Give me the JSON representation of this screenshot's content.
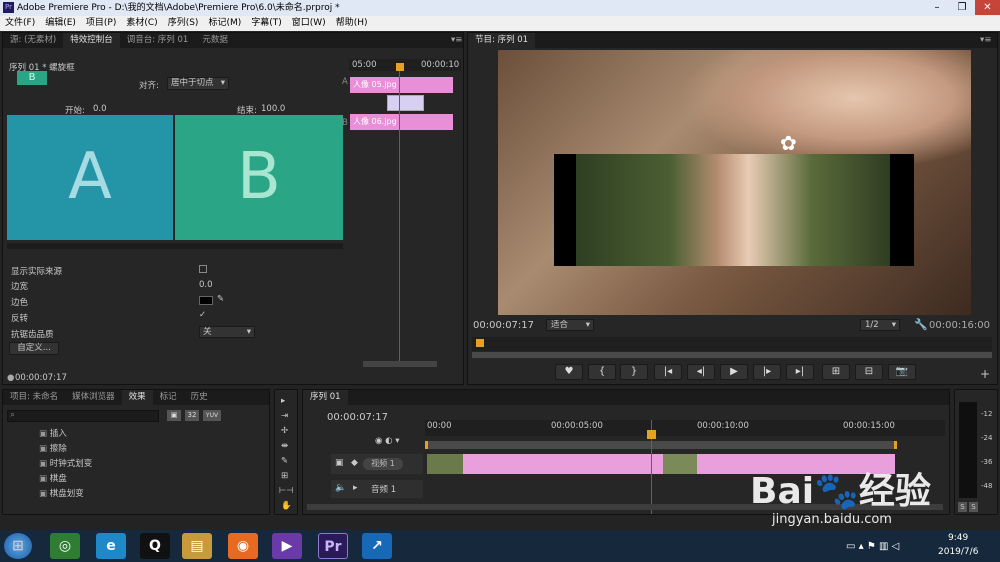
{
  "window": {
    "title": "Adobe Premiere Pro - D:\\我的文档\\Adobe\\Premiere Pro\\6.0\\未命名.prproj *",
    "app_icon": "Pr"
  },
  "menu": [
    "文件(F)",
    "编辑(E)",
    "项目(P)",
    "素材(C)",
    "序列(S)",
    "标记(M)",
    "字幕(T)",
    "窗口(W)",
    "帮助(H)"
  ],
  "left_tabs": [
    "源: (无素材)",
    "特效控制台",
    "调音台: 序列 01",
    "元数据"
  ],
  "effect_controls": {
    "clip_title": "序列 01 * 螺旋框",
    "align_label": "对齐:",
    "align_value": "居中于切点",
    "start_label": "开始:",
    "start_value": "0.0",
    "end_label": "结束:",
    "end_value": "100.0",
    "letter_a": "A",
    "letter_b": "B",
    "thumb_letter": "B",
    "show_source": "显示实际来源",
    "border_width_label": "边宽",
    "border_width_value": "0.0",
    "border_color_label": "边色",
    "reverse_label": "反转",
    "reverse_mark": "✓",
    "aa_label": "抗锯齿品质",
    "aa_value": "关",
    "custom_button": "自定义...",
    "timecode": "00:00:07:17",
    "mini_ruler": [
      "05:00",
      "00:00:10"
    ],
    "clip_a": "人像 05.jpg",
    "clip_b": "人像 06.jpg",
    "a_marker": "A",
    "b_marker": "B"
  },
  "program": {
    "tab": "节目: 序列 01",
    "timecode": "00:00:07:17",
    "fit": "适合",
    "quality": "1/2",
    "duration": "00:00:16:00"
  },
  "transport": [
    "♥",
    "{",
    "}",
    "|◂",
    "◂|",
    "▶",
    "|▸",
    "▸|",
    "⊞",
    "⊟",
    "📷"
  ],
  "project_tabs": [
    "项目: 未命名",
    "媒体浏览器",
    "效果",
    "标记",
    "历史"
  ],
  "effects_list": [
    "插入",
    "擦除",
    "时钟式划变",
    "棋盘",
    "棋盘划变"
  ],
  "effects_badges": [
    "▣",
    "32",
    "YUV"
  ],
  "timeline": {
    "tab": "序列 01",
    "timecode": "00:00:07:17",
    "ruler": [
      "00:00",
      "00:00:05:00",
      "00:00:10:00",
      "00:00:15:00"
    ],
    "video_track": "视频 1",
    "audio_track": "音频 1",
    "transition_label": "螺旋框"
  },
  "meter_scale": [
    "-12",
    "-24",
    "-36",
    "-48"
  ],
  "meter_buttons": [
    "S",
    "S"
  ],
  "tools": [
    "▸",
    "⇥",
    "✢",
    "⇼",
    "✎",
    "⊞",
    "⊢⊣",
    "✋"
  ],
  "watermark": {
    "line1": "Bai",
    "paw": "🐾",
    "line2": "经验",
    "url": "jingyan.baidu.com"
  },
  "taskbar": {
    "time": "9:49",
    "date": "2019/7/6",
    "apps": [
      "Pr"
    ]
  }
}
